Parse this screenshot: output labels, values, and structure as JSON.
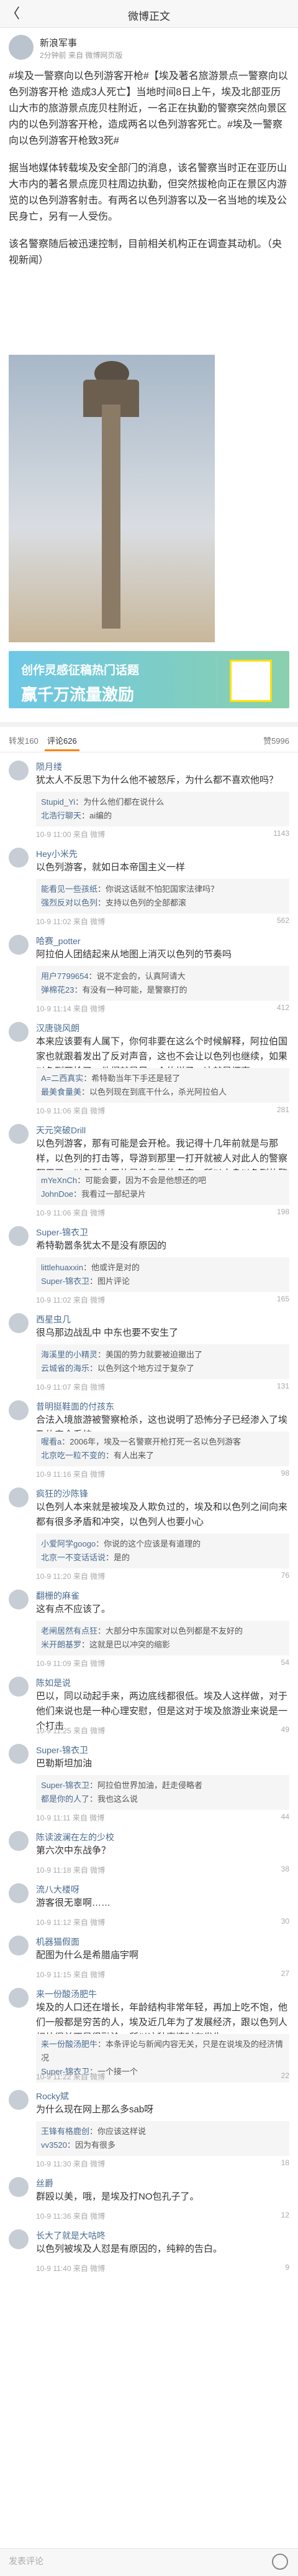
{
  "header": {
    "title": "微博正文",
    "back_label": "〈"
  },
  "post": {
    "author": "新浪军事",
    "meta": "2分钟前 来自 微博网页版",
    "paragraphs": [
      "#埃及一警察向以色列游客开枪#【埃及著名旅游景点一警察向以色列游客开枪 造成3人死亡】当地时间8日上午，埃及北部亚历山大市的旅游景点庞贝柱附近，一名正在执勤的警察突然向景区内的以色列游客开枪，造成两名以色列游客死亡。#埃及一警察向以色列游客开枪致3死#",
      "据当地媒体转载埃及安全部门的消息，该名警察当时正在亚历山大市内的著名景点庞贝柱周边执勤，但突然拔枪向正在景区内游览的以色列游客射击。有两名以色列游客以及一名当地的埃及公民身亡，另有一人受伤。",
      "该名警察随后被迅速控制，目前相关机构正在调查其动机。（央视新闻）"
    ]
  },
  "banner": {
    "line1": "创作灵感征稿热门话题",
    "line2": "赢千万流量激励"
  },
  "tabs": {
    "reposts": "转发160",
    "comments": "评论626",
    "likes": "赞5996"
  },
  "comments": [
    {
      "name": "陨月缕",
      "text": "犹太人不反思下为什么他不被怒斥，为什么都不喜欢他吗？",
      "meta": "10-9 11:00 来自 微博",
      "likes": "1143",
      "replies": [
        {
          "n": "Stupid_Yi",
          "t": "为什么他们都在说什么"
        },
        {
          "n": "北浩行聊天",
          "t": "ai编的"
        }
      ]
    },
    {
      "name": "Hey小米先",
      "text": "以色列游客，就如日本帝国主义一样",
      "meta": "10-9 11:02 来自 微博",
      "likes": "562",
      "replies": [
        {
          "n": "能看见一些孩纸",
          "t": "你说这话就不怕犯国家法律吗？"
        },
        {
          "n": "强烈反对以色列",
          "t": "支持以色列的全部都滚"
        }
      ]
    },
    {
      "name": "哈赛_potter",
      "text": "阿拉伯人团结起来从地图上消灭以色列的节奏吗",
      "meta": "10-9 11:14 来自 微博",
      "likes": "412",
      "replies": [
        {
          "n": "用户7799654",
          "t": "说不定会的，认真阿请大"
        },
        {
          "n": "弹棉花23",
          "t": "有没有一种可能，是警察打的"
        }
      ]
    },
    {
      "name": "汉唐骁风朗",
      "text": "本来应该要有人属下，你何非要在这么个时候解释，阿拉伯国家也就跟着发出了反对声音，这也不会让以色列也继续，如果以色列开枪了，他们就是另一个的样子，这就是坏事",
      "meta": "10-9 11:06 来自 微博",
      "likes": "281",
      "replies": [
        {
          "n": "A=二西真实",
          "t": "希特勒当年下手还是轻了"
        },
        {
          "n": "最美食量美",
          "t": "以色列现在到底干什么，杀光阿拉伯人"
        }
      ]
    },
    {
      "name": "天元突破Drill",
      "text": "以色列游客，那有可能是会开枪。我记得十几年前就是与那样，以色列的打击等，导游到那里一打开就被人对此人的警察都用了，以色列人用的是给自己的名字，所以本身以色列的警察又有一定的那样，那就是另一个的警察了",
      "meta": "10-9 11:06 来自 微博",
      "likes": "198",
      "replies": [
        {
          "n": "mYeXnCh",
          "t": "可能会要，因为不会是他想还的吧"
        },
        {
          "n": "JohnDoe",
          "t": "我看过一部纪录片"
        }
      ]
    },
    {
      "name": "Super-锦衣卫",
      "text": "希特勒嚣条犹太不是没有原因的",
      "meta": "10-9 11:02 来自 微博",
      "likes": "165",
      "replies": [
        {
          "n": "littlehuaxxin",
          "t": "他或许是对的"
        },
        {
          "n": "Super-锦衣卫",
          "t": "图片评论"
        }
      ]
    },
    {
      "name": "西星虫几",
      "text": "很乌那边战乱中 中东也要不安生了",
      "meta": "10-9 11:07 来自 微博",
      "likes": "131",
      "replies": [
        {
          "n": "海溪里的小精灵",
          "t": "美国的势力就要被迫撤出了"
        },
        {
          "n": "云城省的海乐",
          "t": "以色列这个地方过于复杂了"
        }
      ]
    },
    {
      "name": "昔明挺鞋面的付孩东",
      "text": "合法入境旅游被警察枪杀，这也说明了恐怖分子已经渗入了埃及的安全系统",
      "meta": "10-9 11:16 来自 微博",
      "likes": "98",
      "replies": [
        {
          "n": "喔看a",
          "t": "2006年，埃及一名警察开枪打死一名以色列游客"
        },
        {
          "n": "北京吃一粒不变的",
          "t": "有人出来了"
        }
      ]
    },
    {
      "name": "疯狂的沙陈锋",
      "text": "以色列人本来就是被埃及人欺负过的，埃及和以色列之间向来都有很多矛盾和冲突，以色列人也要小心",
      "meta": "10-9 11:20 来自 微博",
      "likes": "76",
      "replies": [
        {
          "n": "小爱阿学googo",
          "t": "你说的这个应该是有道理的"
        },
        {
          "n": "北京一不变话话说",
          "t": "是的"
        }
      ]
    },
    {
      "name": "翻栅的麻雀",
      "text": "这有点不应该了。",
      "meta": "10-9 11:09 来自 微博",
      "likes": "54",
      "replies": [
        {
          "n": "老闸居然有点狂",
          "t": "大部分中东国家对以色列都是不友好的"
        },
        {
          "n": "米开朗基罗",
          "t": "这就是巴以冲突的缩影"
        }
      ]
    },
    {
      "name": "陈如是说",
      "text": "巴以，同以动起手来，两边底线都很低。埃及人这样做，对于他们来说也是一种心理安慰，但是这对于埃及旅游业来说是一个打击",
      "meta": "10-9 11:25 来自 微博",
      "likes": "49",
      "replies": []
    },
    {
      "name": "Super-锦衣卫",
      "text": "巴勒斯坦加油",
      "meta": "10-9 11:11 来自 微博",
      "likes": "44",
      "replies": [
        {
          "n": "Super-锦衣卫",
          "t": "阿拉伯世界加油，赶走侵略者"
        },
        {
          "n": "都是你的人了",
          "t": "我也这么说"
        }
      ]
    },
    {
      "name": "陈读波澜在左的少校",
      "text": "第六次中东战争？",
      "meta": "10-9 11:18 来自 微博",
      "likes": "38",
      "replies": []
    },
    {
      "name": "流八大楼呀",
      "text": "游客很无辜啊……",
      "meta": "10-9 11:12 来自 微博",
      "likes": "30",
      "replies": []
    },
    {
      "name": "机器猫假面",
      "text": "配图为什么是希腊庙宇啊",
      "meta": "10-9 11:15 来自 微博",
      "likes": "27",
      "replies": []
    },
    {
      "name": "来一份酸汤肥牛",
      "text": "埃及的人口还在增长，年龄结构非常年轻，再加上吃不饱，他们一般都是穷苦的人，埃及近几年为了发展经济，跟以色列人相处得并不是很融洽，所以这种事情时有发生",
      "meta": "10-9 11:22 来自 微博",
      "likes": "22",
      "replies": [
        {
          "n": "来一份酸汤肥牛",
          "t": "本条评论与新闻内容无关，只是在说埃及的经济情况"
        },
        {
          "n": "Super-锦衣卫",
          "t": "一个接一个"
        }
      ]
    },
    {
      "name": "Rocky斌",
      "text": "为什么现在网上那么多sab呀",
      "meta": "10-9 11:30 来自 微博",
      "likes": "18",
      "replies": [
        {
          "n": "王锋有格鹿创",
          "t": "你应该这样说"
        },
        {
          "n": "vv3520",
          "t": "因为有很多"
        }
      ]
    },
    {
      "name": "丝爵",
      "text": "群殴以美，哦，是埃及打NO包孔子了。",
      "meta": "10-9 11:36 来自 微博",
      "likes": "12",
      "replies": []
    },
    {
      "name": "长大了就是大咕咚",
      "text": "以色列被埃及人怼是有原因的，纯粹的告白。",
      "meta": "10-9 11:40 来自 微博",
      "likes": "9",
      "replies": []
    }
  ],
  "bottom": {
    "placeholder": "发表评论"
  }
}
